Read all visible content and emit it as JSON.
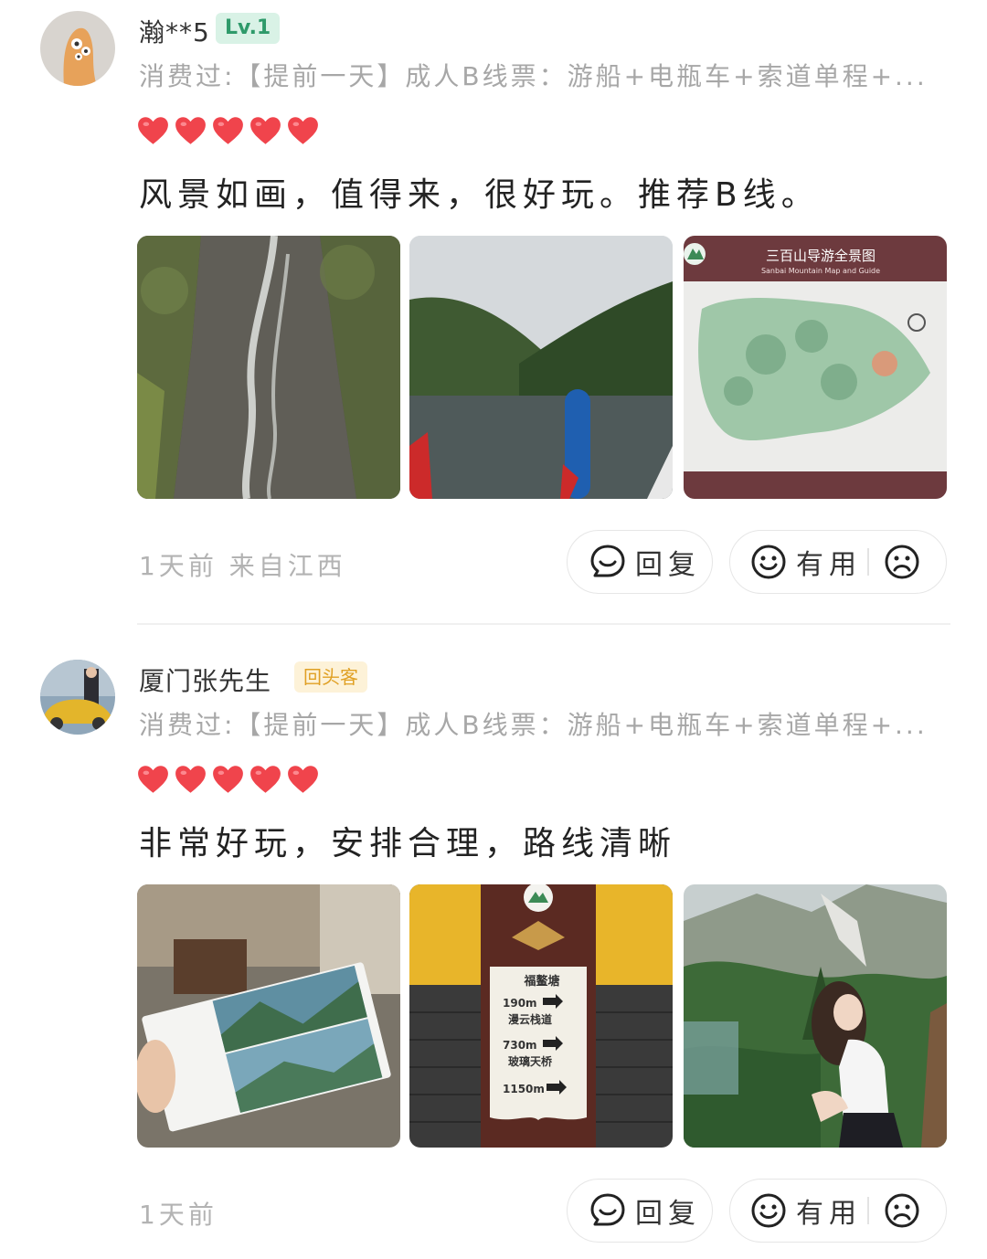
{
  "reviews": [
    {
      "username": "瀚**5",
      "badge": "Lv.1",
      "purchase": "消费过:【提前一天】成人B线票：游船+电瓶车+索道单程+...",
      "rating": 5,
      "text": "风景如画，值得来，很好玩。推荐B线。",
      "photos": [
        "waterfall-photo",
        "lake-photo",
        "park-map-photo"
      ],
      "map_title": "三百山导游全景图",
      "map_subtitle": "Sanbai Mountain Map and Guide",
      "meta": "1天前  来自江西",
      "reply_label": "回复",
      "useful_label": "有用"
    },
    {
      "username": "厦门张先生",
      "badge": "回头客",
      "purchase": "消费过:【提前一天】成人B线票：游船+电瓶车+索道单程+...",
      "rating": 5,
      "text": "非常好玩，安排合理，路线清晰",
      "photos": [
        "tickets-photo",
        "signpost-photo",
        "scenic-portrait-photo"
      ],
      "sign": {
        "items": [
          {
            "name": "福鳌塘",
            "dist": "190m"
          },
          {
            "name": "漫云栈道",
            "dist": "730m"
          },
          {
            "name": "玻璃天桥",
            "dist": "1150m"
          }
        ]
      },
      "meta": "1天前",
      "reply_label": "回复",
      "useful_label": "有用"
    }
  ],
  "colors": {
    "heart": "#f0444c",
    "lv_badge_bg": "#d9f2e6",
    "lv_badge_text": "#2e9a6a",
    "return_badge_bg": "#fdf2d8",
    "return_badge_text": "#e0a024",
    "muted_text": "#a7a7a7"
  },
  "icons": [
    "reply-icon",
    "smile-icon",
    "frown-icon",
    "heart-icon"
  ]
}
